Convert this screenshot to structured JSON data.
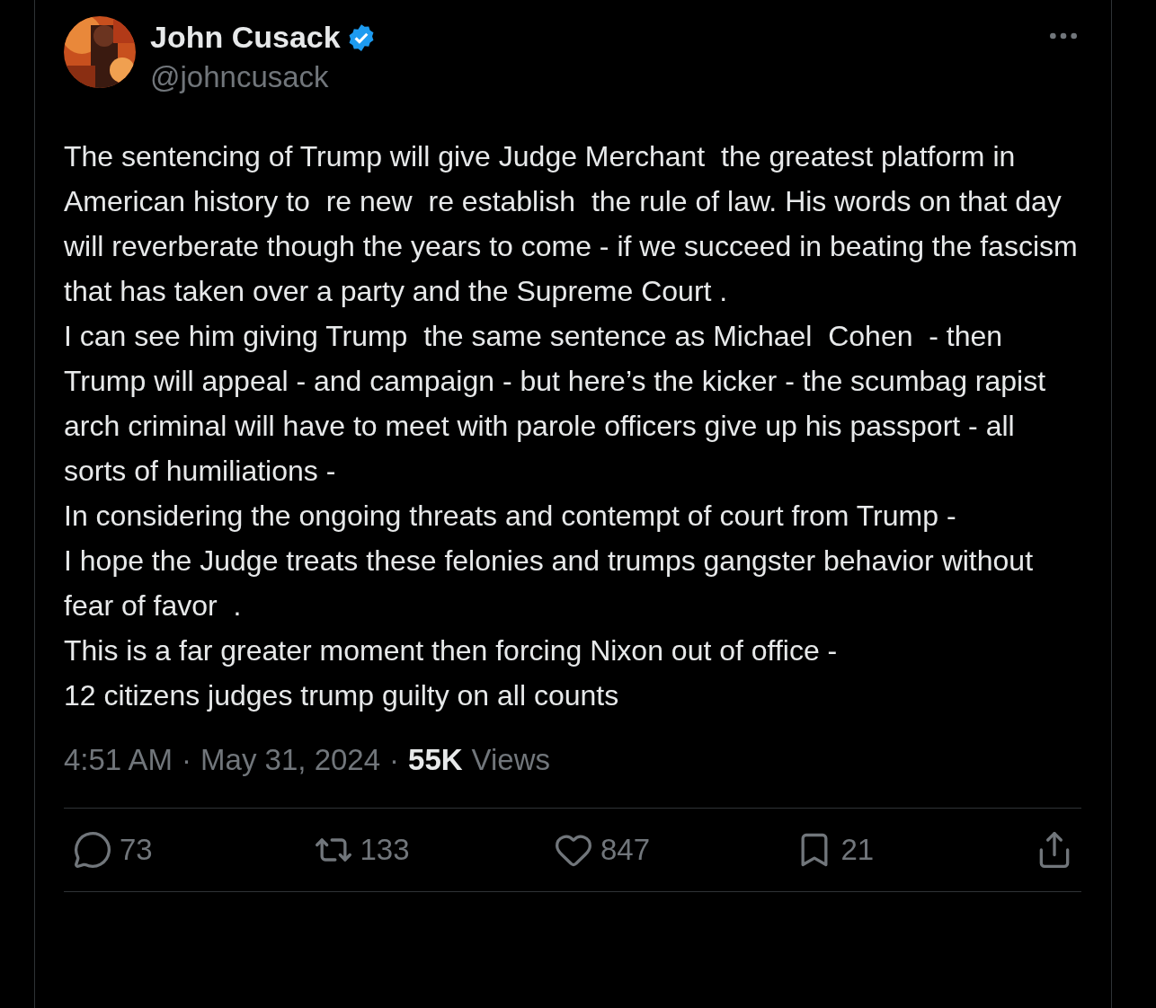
{
  "author": {
    "name": "John Cusack",
    "handle": "@johncusack",
    "verified": true
  },
  "post": {
    "paragraphs": [
      "The sentencing of Trump will give Judge Merchant  the greatest platform in American history to  re new  re establish  the rule of law. His words on that day will reverberate though the years to come - if we succeed in beating the fascism  that has taken over a party and the Supreme Court .",
      "I can see him giving Trump  the same sentence as Michael  Cohen  - then Trump will appeal - and campaign - but here’s the kicker - the scumbag rapist arch criminal will have to meet with parole officers give up his passport - all sorts of humiliations -",
      "In considering the ongoing threats and contempt of court from Trump -",
      "I hope the Judge treats these felonies and trumps gangster behavior without fear of favor  .",
      "This is a far greater moment then forcing Nixon out of office -",
      "12 citizens judges trump guilty on all counts"
    ]
  },
  "meta": {
    "time": "4:51 AM",
    "separator": "·",
    "date": "May 31, 2024",
    "views": "55K",
    "views_label": "Views"
  },
  "actions": [
    {
      "kind": "reply",
      "count": "73"
    },
    {
      "kind": "repost",
      "count": "133"
    },
    {
      "kind": "like",
      "count": "847"
    },
    {
      "kind": "bookmark",
      "count": "21"
    },
    {
      "kind": "share"
    }
  ]
}
